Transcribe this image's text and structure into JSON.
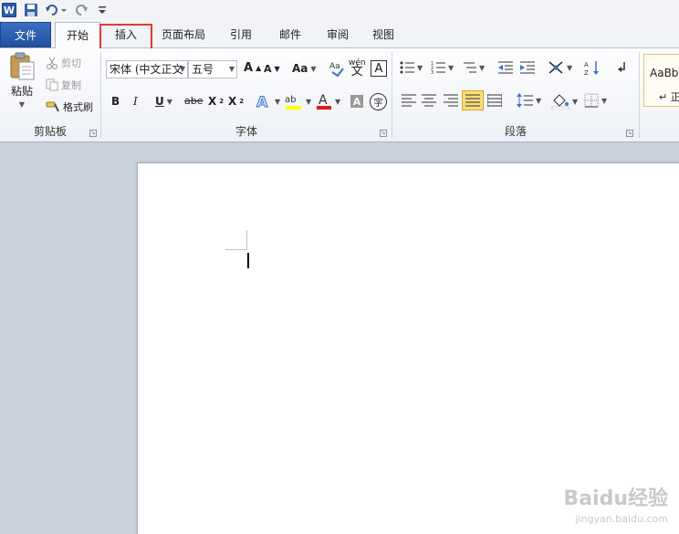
{
  "tabs": {
    "file": "文件",
    "home": "开始",
    "insert": "插入",
    "page_layout": "页面布局",
    "references": "引用",
    "mailings": "邮件",
    "review": "审阅",
    "view": "视图"
  },
  "clipboard": {
    "paste": "粘贴",
    "cut": "剪切",
    "copy": "复制",
    "format_painter": "格式刷",
    "group_label": "剪贴板"
  },
  "font": {
    "font_name": "宋体 (中文正文",
    "font_size": "五号",
    "grow_label": "A",
    "shrink_label": "A",
    "change_case_label": "Aa",
    "bold_label": "B",
    "italic_label": "I",
    "underline_label": "U",
    "strike_label": "abe",
    "subscript_label": "X",
    "superscript_label": "X",
    "wen_label": "wén",
    "wen_char": "文",
    "border_char": "A",
    "enclose_char": "字",
    "highlight_label": "ab",
    "group_label": "字体"
  },
  "paragraph": {
    "group_label": "段落"
  },
  "styles": {
    "preview": "AaBb",
    "name": "↵ 正"
  },
  "colors": {
    "accent": "#2b5797",
    "highlight_box": "#e03a3a",
    "font_color_bar": "#e01b1b",
    "highlight_bar": "#ffff00"
  },
  "watermark": {
    "brand": "Baidu经验",
    "url": "jingyan.baidu.com"
  }
}
